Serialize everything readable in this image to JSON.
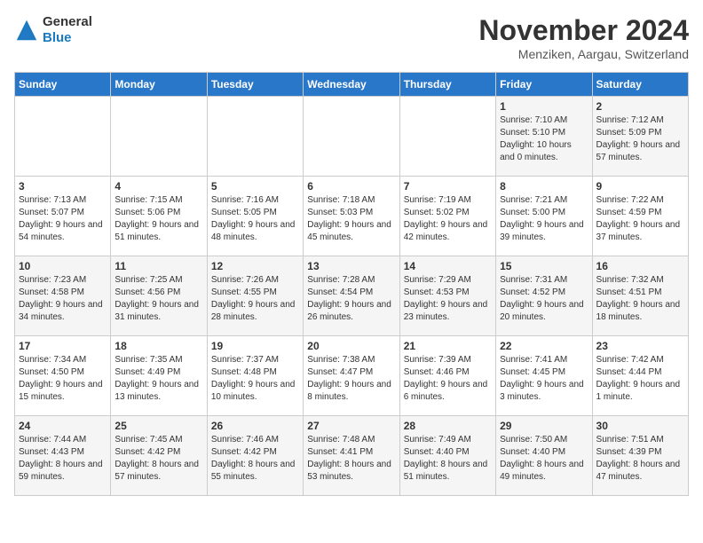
{
  "logo": {
    "line1": "General",
    "line2": "Blue"
  },
  "title": "November 2024",
  "subtitle": "Menziken, Aargau, Switzerland",
  "days_of_week": [
    "Sunday",
    "Monday",
    "Tuesday",
    "Wednesday",
    "Thursday",
    "Friday",
    "Saturday"
  ],
  "weeks": [
    [
      {
        "day": "",
        "info": ""
      },
      {
        "day": "",
        "info": ""
      },
      {
        "day": "",
        "info": ""
      },
      {
        "day": "",
        "info": ""
      },
      {
        "day": "",
        "info": ""
      },
      {
        "day": "1",
        "info": "Sunrise: 7:10 AM\nSunset: 5:10 PM\nDaylight: 10 hours and 0 minutes."
      },
      {
        "day": "2",
        "info": "Sunrise: 7:12 AM\nSunset: 5:09 PM\nDaylight: 9 hours and 57 minutes."
      }
    ],
    [
      {
        "day": "3",
        "info": "Sunrise: 7:13 AM\nSunset: 5:07 PM\nDaylight: 9 hours and 54 minutes."
      },
      {
        "day": "4",
        "info": "Sunrise: 7:15 AM\nSunset: 5:06 PM\nDaylight: 9 hours and 51 minutes."
      },
      {
        "day": "5",
        "info": "Sunrise: 7:16 AM\nSunset: 5:05 PM\nDaylight: 9 hours and 48 minutes."
      },
      {
        "day": "6",
        "info": "Sunrise: 7:18 AM\nSunset: 5:03 PM\nDaylight: 9 hours and 45 minutes."
      },
      {
        "day": "7",
        "info": "Sunrise: 7:19 AM\nSunset: 5:02 PM\nDaylight: 9 hours and 42 minutes."
      },
      {
        "day": "8",
        "info": "Sunrise: 7:21 AM\nSunset: 5:00 PM\nDaylight: 9 hours and 39 minutes."
      },
      {
        "day": "9",
        "info": "Sunrise: 7:22 AM\nSunset: 4:59 PM\nDaylight: 9 hours and 37 minutes."
      }
    ],
    [
      {
        "day": "10",
        "info": "Sunrise: 7:23 AM\nSunset: 4:58 PM\nDaylight: 9 hours and 34 minutes."
      },
      {
        "day": "11",
        "info": "Sunrise: 7:25 AM\nSunset: 4:56 PM\nDaylight: 9 hours and 31 minutes."
      },
      {
        "day": "12",
        "info": "Sunrise: 7:26 AM\nSunset: 4:55 PM\nDaylight: 9 hours and 28 minutes."
      },
      {
        "day": "13",
        "info": "Sunrise: 7:28 AM\nSunset: 4:54 PM\nDaylight: 9 hours and 26 minutes."
      },
      {
        "day": "14",
        "info": "Sunrise: 7:29 AM\nSunset: 4:53 PM\nDaylight: 9 hours and 23 minutes."
      },
      {
        "day": "15",
        "info": "Sunrise: 7:31 AM\nSunset: 4:52 PM\nDaylight: 9 hours and 20 minutes."
      },
      {
        "day": "16",
        "info": "Sunrise: 7:32 AM\nSunset: 4:51 PM\nDaylight: 9 hours and 18 minutes."
      }
    ],
    [
      {
        "day": "17",
        "info": "Sunrise: 7:34 AM\nSunset: 4:50 PM\nDaylight: 9 hours and 15 minutes."
      },
      {
        "day": "18",
        "info": "Sunrise: 7:35 AM\nSunset: 4:49 PM\nDaylight: 9 hours and 13 minutes."
      },
      {
        "day": "19",
        "info": "Sunrise: 7:37 AM\nSunset: 4:48 PM\nDaylight: 9 hours and 10 minutes."
      },
      {
        "day": "20",
        "info": "Sunrise: 7:38 AM\nSunset: 4:47 PM\nDaylight: 9 hours and 8 minutes."
      },
      {
        "day": "21",
        "info": "Sunrise: 7:39 AM\nSunset: 4:46 PM\nDaylight: 9 hours and 6 minutes."
      },
      {
        "day": "22",
        "info": "Sunrise: 7:41 AM\nSunset: 4:45 PM\nDaylight: 9 hours and 3 minutes."
      },
      {
        "day": "23",
        "info": "Sunrise: 7:42 AM\nSunset: 4:44 PM\nDaylight: 9 hours and 1 minute."
      }
    ],
    [
      {
        "day": "24",
        "info": "Sunrise: 7:44 AM\nSunset: 4:43 PM\nDaylight: 8 hours and 59 minutes."
      },
      {
        "day": "25",
        "info": "Sunrise: 7:45 AM\nSunset: 4:42 PM\nDaylight: 8 hours and 57 minutes."
      },
      {
        "day": "26",
        "info": "Sunrise: 7:46 AM\nSunset: 4:42 PM\nDaylight: 8 hours and 55 minutes."
      },
      {
        "day": "27",
        "info": "Sunrise: 7:48 AM\nSunset: 4:41 PM\nDaylight: 8 hours and 53 minutes."
      },
      {
        "day": "28",
        "info": "Sunrise: 7:49 AM\nSunset: 4:40 PM\nDaylight: 8 hours and 51 minutes."
      },
      {
        "day": "29",
        "info": "Sunrise: 7:50 AM\nSunset: 4:40 PM\nDaylight: 8 hours and 49 minutes."
      },
      {
        "day": "30",
        "info": "Sunrise: 7:51 AM\nSunset: 4:39 PM\nDaylight: 8 hours and 47 minutes."
      }
    ]
  ]
}
